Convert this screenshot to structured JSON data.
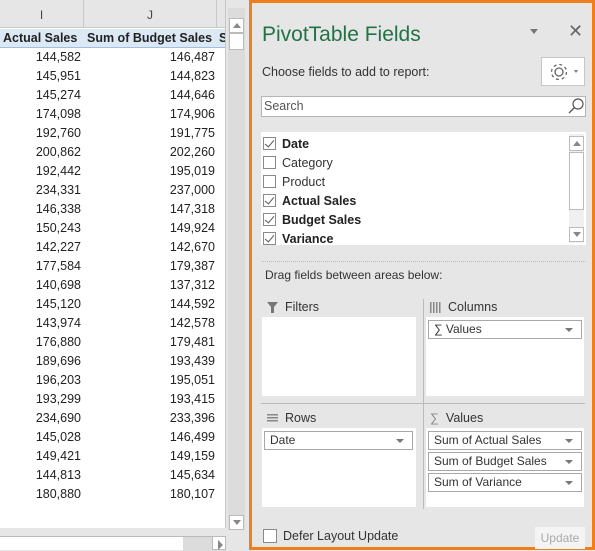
{
  "spreadsheet": {
    "column_letters": [
      "I",
      "J"
    ],
    "headers": [
      "Actual Sales",
      "Sum of Budget Sales",
      "S"
    ],
    "rows": [
      [
        "144,582",
        "146,487"
      ],
      [
        "145,951",
        "144,823"
      ],
      [
        "145,274",
        "144,646"
      ],
      [
        "174,098",
        "174,906"
      ],
      [
        "192,760",
        "191,775"
      ],
      [
        "200,862",
        "202,260"
      ],
      [
        "192,442",
        "195,019"
      ],
      [
        "234,331",
        "237,000"
      ],
      [
        "146,338",
        "147,318"
      ],
      [
        "150,243",
        "149,924"
      ],
      [
        "142,227",
        "142,670"
      ],
      [
        "177,584",
        "179,387"
      ],
      [
        "140,698",
        "137,312"
      ],
      [
        "145,120",
        "144,592"
      ],
      [
        "143,974",
        "142,578"
      ],
      [
        "176,880",
        "179,481"
      ],
      [
        "189,696",
        "193,439"
      ],
      [
        "196,203",
        "195,051"
      ],
      [
        "193,299",
        "193,415"
      ],
      [
        "234,690",
        "233,396"
      ],
      [
        "145,028",
        "146,499"
      ],
      [
        "149,421",
        "149,159"
      ],
      [
        "144,813",
        "145,634"
      ],
      [
        "180,880",
        "180,107"
      ]
    ]
  },
  "panel": {
    "title": "PivotTable Fields",
    "choose_label": "Choose fields to add to report:",
    "search_placeholder": "Search",
    "fields": [
      {
        "label": "Date",
        "checked": true
      },
      {
        "label": "Category",
        "checked": false
      },
      {
        "label": "Product",
        "checked": false
      },
      {
        "label": "Actual Sales",
        "checked": true
      },
      {
        "label": "Budget Sales",
        "checked": true
      },
      {
        "label": "Variance",
        "checked": true
      }
    ],
    "drag_label": "Drag fields between areas below:",
    "areas": {
      "filters": {
        "label": "Filters",
        "items": []
      },
      "columns": {
        "label": "Columns",
        "items": [
          "Values"
        ]
      },
      "rows": {
        "label": "Rows",
        "items": [
          "Date"
        ]
      },
      "values": {
        "label": "Values",
        "items": [
          "Sum of Actual Sales",
          "Sum of Budget Sales",
          "Sum of Variance"
        ]
      }
    },
    "defer_label": "Defer Layout Update",
    "update_label": "Update",
    "accent_color": "#f07f1b",
    "title_color": "#217346"
  }
}
